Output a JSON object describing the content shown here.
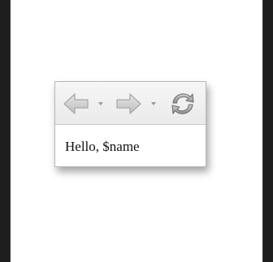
{
  "toolbar": {
    "back_icon": "back-arrow-icon",
    "back_dropdown_icon": "dropdown-triangle-icon",
    "forward_icon": "forward-arrow-icon",
    "forward_dropdown_icon": "dropdown-triangle-icon",
    "refresh_icon": "refresh-icon"
  },
  "content": {
    "text": "Hello, $name"
  },
  "colors": {
    "icon_disabled": "#c4c4c4",
    "refresh_icon": "#8a8a8a",
    "page_background": "#ffffff",
    "outer_background": "#1e1e1e"
  }
}
